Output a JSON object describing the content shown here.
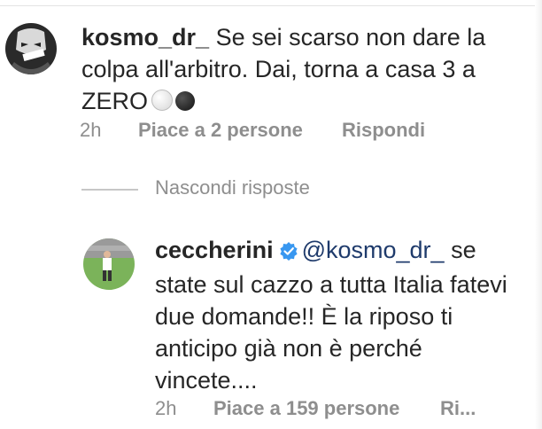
{
  "comment1": {
    "username": "kosmo_dr_",
    "text": "Se sei scarso non dare la colpa all'arbitro. Dai, torna a casa 3 a ZERO",
    "time": "2h",
    "likes": "Piace a 2 persone",
    "reply": "Rispondi"
  },
  "replies_toggle": "Nascondi risposte",
  "comment2": {
    "username": "ceccherini",
    "verified": true,
    "mention": "@kosmo_dr_",
    "text": "se state sul cazzo a tutta Italia fatevi due domande!! È la riposo ti anticipo già non è perché vincete....",
    "time": "2h",
    "likes": "Piace a 159 persone",
    "reply": "Ri..."
  },
  "icons": [
    "avatar-image",
    "white-ball-emoji",
    "black-ball-emoji",
    "verified-badge-icon"
  ],
  "colors": {
    "text": "#262626",
    "meta": "#8e8e8e",
    "verified": "#3897f0"
  }
}
